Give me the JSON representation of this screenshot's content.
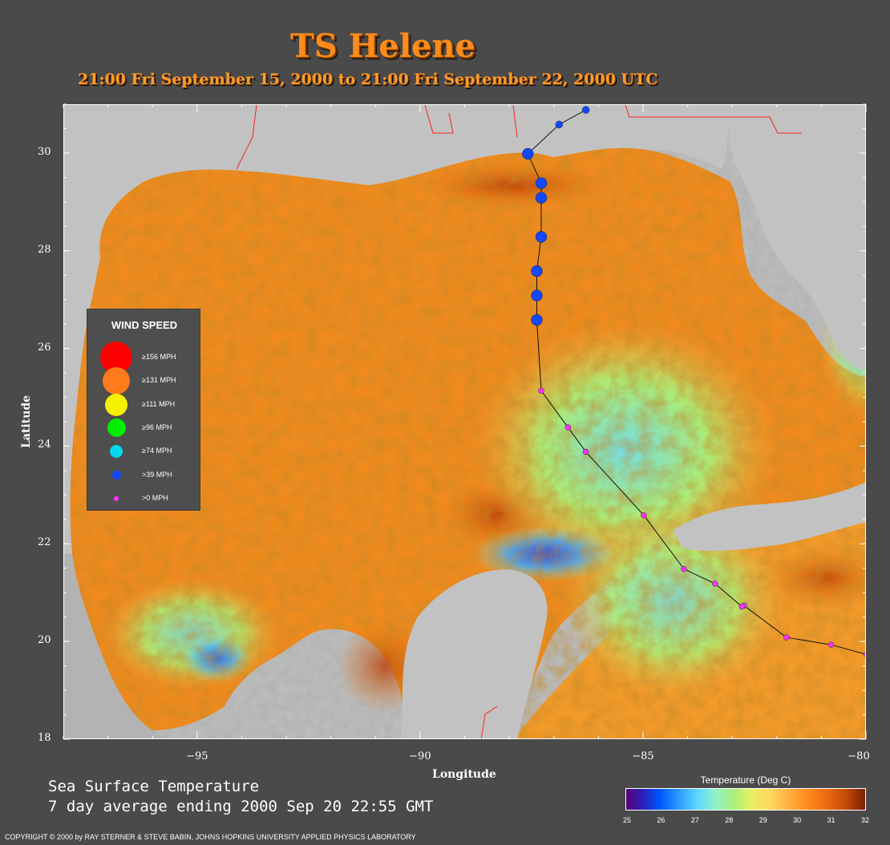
{
  "header": {
    "title": "TS Helene",
    "subtitle": "21:00 Fri September 15, 2000 to 21:00 Fri September 22, 2000  UTC"
  },
  "map": {
    "projection": "lon/lat equirectangular",
    "lon_range": [
      -98,
      -80
    ],
    "lat_range": [
      18,
      31
    ],
    "x_ticks": [
      {
        "value": -95,
        "label": "−95"
      },
      {
        "value": -90,
        "label": "−90"
      },
      {
        "value": -85,
        "label": "−85"
      },
      {
        "value": -80,
        "label": "−80"
      }
    ],
    "y_ticks": [
      {
        "value": 30,
        "label": "30"
      },
      {
        "value": 28,
        "label": "28"
      },
      {
        "value": 26,
        "label": "26"
      },
      {
        "value": 24,
        "label": "24"
      },
      {
        "value": 22,
        "label": "22"
      },
      {
        "value": 20,
        "label": "20"
      },
      {
        "value": 18,
        "label": "18"
      }
    ],
    "xlabel": "Longitude",
    "ylabel": "Latitude",
    "track_color": "#111111",
    "storm_track": [
      {
        "lon": -80.0,
        "lat": 19.75,
        "category": "gt0"
      },
      {
        "lon": -80.8,
        "lat": 19.95,
        "category": "gt0"
      },
      {
        "lon": -81.8,
        "lat": 20.1,
        "category": "gt0"
      },
      {
        "lon": -82.75,
        "lat": 20.75,
        "category": "gt0"
      },
      {
        "lon": -82.8,
        "lat": 20.73,
        "category": "gt0"
      },
      {
        "lon": -83.4,
        "lat": 21.2,
        "category": "gt0"
      },
      {
        "lon": -84.1,
        "lat": 21.5,
        "category": "gt0"
      },
      {
        "lon": -85.0,
        "lat": 22.6,
        "category": "gt0"
      },
      {
        "lon": -86.3,
        "lat": 23.9,
        "category": "gt0"
      },
      {
        "lon": -86.7,
        "lat": 24.4,
        "category": "gt0"
      },
      {
        "lon": -87.3,
        "lat": 25.15,
        "category": "gt0"
      },
      {
        "lon": -87.4,
        "lat": 26.6,
        "category": "gt39"
      },
      {
        "lon": -87.4,
        "lat": 27.1,
        "category": "gt39"
      },
      {
        "lon": -87.4,
        "lat": 27.6,
        "category": "gt39"
      },
      {
        "lon": -87.3,
        "lat": 28.3,
        "category": "gt39"
      },
      {
        "lon": -87.3,
        "lat": 29.1,
        "category": "gt39"
      },
      {
        "lon": -87.3,
        "lat": 29.4,
        "category": "gt39"
      },
      {
        "lon": -87.6,
        "lat": 30.0,
        "category": "gt39"
      },
      {
        "lon": -86.9,
        "lat": 30.6,
        "category": "gt39"
      },
      {
        "lon": -86.3,
        "lat": 30.9,
        "category": "gt39"
      }
    ]
  },
  "legend": {
    "title": "WIND SPEED",
    "items": [
      {
        "label": "≥156 MPH",
        "color": "#ff0000",
        "size": 40
      },
      {
        "label": "≥131 MPH",
        "color": "#ff7a1a",
        "size": 34
      },
      {
        "label": "≥111 MPH",
        "color": "#f5f000",
        "size": 28
      },
      {
        "label": "≥96 MPH",
        "color": "#00ee00",
        "size": 23
      },
      {
        "label": "≥74 MPH",
        "color": "#00d8f0",
        "size": 16
      },
      {
        "label": ">39 MPH",
        "color": "#1447ff",
        "size": 11
      },
      {
        "label": ">0 MPH",
        "color": "#ff33ff",
        "size": 6
      }
    ]
  },
  "caption": {
    "line1": "Sea Surface Temperature",
    "line2": "7 day average ending 2000 Sep 20 22:55 GMT"
  },
  "colorbar": {
    "title": "Temperature (Deg C)",
    "ticks": [
      "25",
      "26",
      "27",
      "28",
      "29",
      "30",
      "31",
      "32"
    ],
    "range": [
      25,
      32
    ]
  },
  "footer": {
    "copyright": "COPYRIGHT © 2000 by RAY STERNER & STEVE BABIN, JOHNS HOPKINS UNIVERSITY APPLIED PHYSICS LABORATORY"
  }
}
